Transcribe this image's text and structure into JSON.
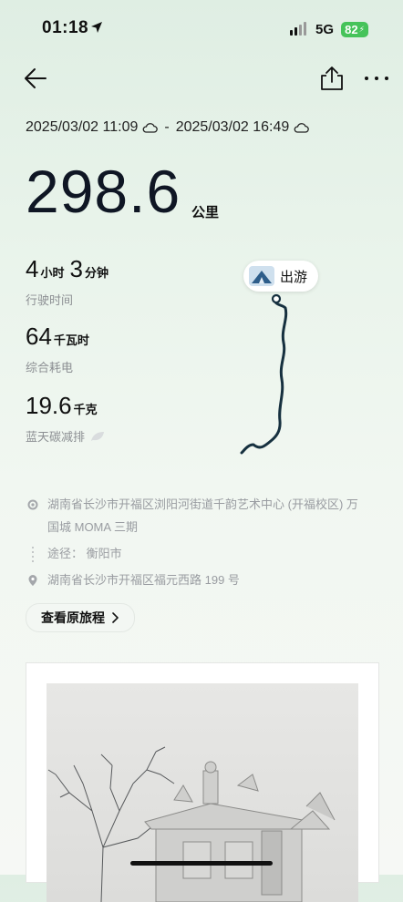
{
  "status_bar": {
    "time": "01:18",
    "network": "5G",
    "battery": "82"
  },
  "trip": {
    "start": "2025/03/02 11:09",
    "separator": "-",
    "end": "2025/03/02 16:49",
    "distance": "298.6",
    "distance_unit": "公里"
  },
  "stats": {
    "drive_time": {
      "hours": "4",
      "hours_unit": "小时",
      "minutes": "3",
      "minutes_unit": "分钟",
      "label": "行驶时间"
    },
    "energy": {
      "value": "64",
      "unit": "千瓦时",
      "label": "综合耗电"
    },
    "carbon": {
      "value": "19.6",
      "unit": "千克",
      "label": "蓝天碳减排"
    }
  },
  "map": {
    "destination_label": "出游",
    "route_color": "#16303f"
  },
  "addresses": {
    "start_line1": "湖南省长沙市开福区浏阳河街道千韵艺术中心 (开福校区) 万",
    "start_line2": "国城 MOMA 三期",
    "via": "途径： 衡阳市",
    "end": "湖南省长沙市开福区福元西路 199 号"
  },
  "view_original_button": "查看原旅程",
  "icons": {
    "back": "arrow-left-icon",
    "share": "share-icon",
    "more": "more-icon",
    "location": "location-arrow-icon",
    "weather": "cloud-icon",
    "leaf": "leaf-icon",
    "tent": "tent-icon",
    "start_dot": "start-dot-icon",
    "pin": "pin-icon",
    "chevron": "chevron-right-icon"
  }
}
